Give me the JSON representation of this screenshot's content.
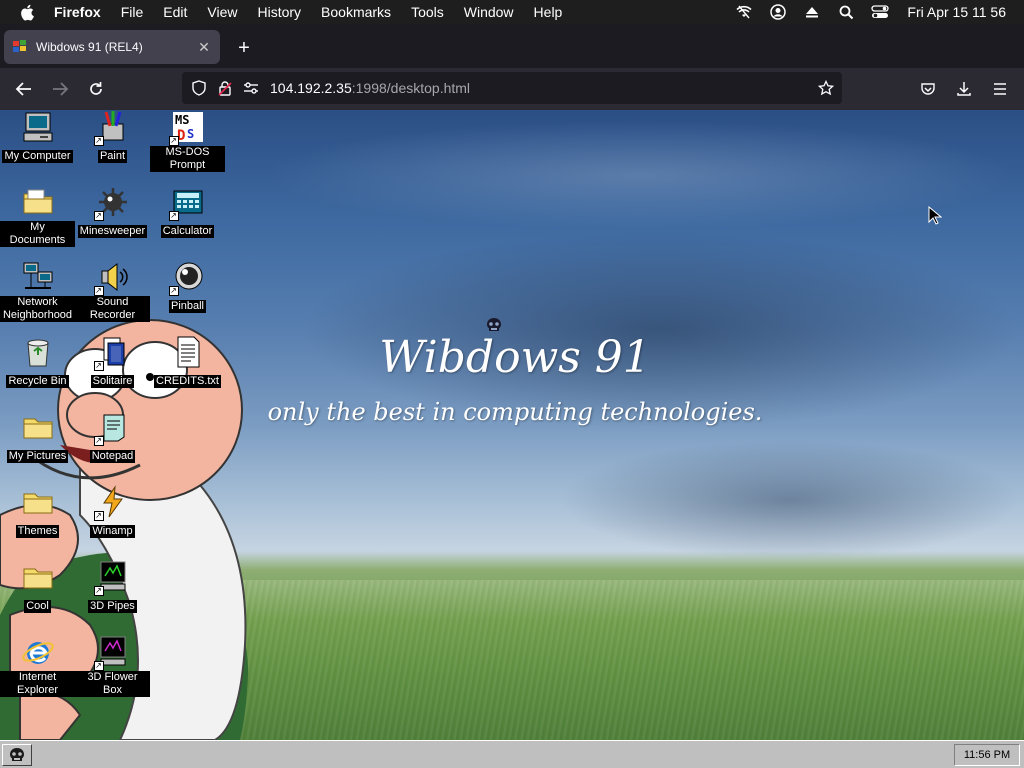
{
  "menubar": {
    "app_name": "Firefox",
    "items": [
      "File",
      "Edit",
      "View",
      "History",
      "Bookmarks",
      "Tools",
      "Window",
      "Help"
    ],
    "clock": "Fri Apr 15  11 56"
  },
  "browser": {
    "tab_title": "Wibdows 91 (REL4)",
    "close_glyph": "✕",
    "new_tab_glyph": "+",
    "url_host": "104.192.2.35",
    "url_path": ":1998/desktop.html"
  },
  "desktop": {
    "brand": "Wibdows 91",
    "tagline": "only the best in computing technologies.",
    "icons": [
      {
        "label": "My Computer",
        "icon": "my-computer-icon"
      },
      {
        "label": "Paint",
        "icon": "paint-icon"
      },
      {
        "label": "MS-DOS Prompt",
        "icon": "ms-dos-icon"
      },
      {
        "label": "My Documents",
        "icon": "folder-icon"
      },
      {
        "label": "Minesweeper",
        "icon": "minesweeper-icon"
      },
      {
        "label": "Calculator",
        "icon": "calculator-icon"
      },
      {
        "label": "Network Neighborhood",
        "icon": "network-icon"
      },
      {
        "label": "Sound Recorder",
        "icon": "sound-recorder-icon"
      },
      {
        "label": "Pinball",
        "icon": "pinball-icon"
      },
      {
        "label": "Recycle Bin",
        "icon": "recycle-bin-icon"
      },
      {
        "label": "Solitaire",
        "icon": "solitaire-icon"
      },
      {
        "label": "CREDITS.txt",
        "icon": "text-file-icon"
      },
      {
        "label": "My Pictures",
        "icon": "folder-icon"
      },
      {
        "label": "Notepad",
        "icon": "notepad-icon"
      },
      {
        "label": "Themes",
        "icon": "folder-icon"
      },
      {
        "label": "Winamp",
        "icon": "winamp-icon"
      },
      {
        "label": "Cool",
        "icon": "folder-icon"
      },
      {
        "label": "3D Pipes",
        "icon": "screensaver-icon"
      },
      {
        "label": "Internet Explorer",
        "icon": "internet-explorer-icon"
      },
      {
        "label": "3D Flower Box",
        "icon": "screensaver-icon"
      }
    ]
  },
  "taskbar": {
    "time": "11:56 PM"
  },
  "colors": {
    "menubar_bg": "#1e1e1e",
    "tabstrip_bg": "#1c1b22",
    "navbar_bg": "#2b2a33",
    "taskbar_bg": "#bfbfbf"
  }
}
